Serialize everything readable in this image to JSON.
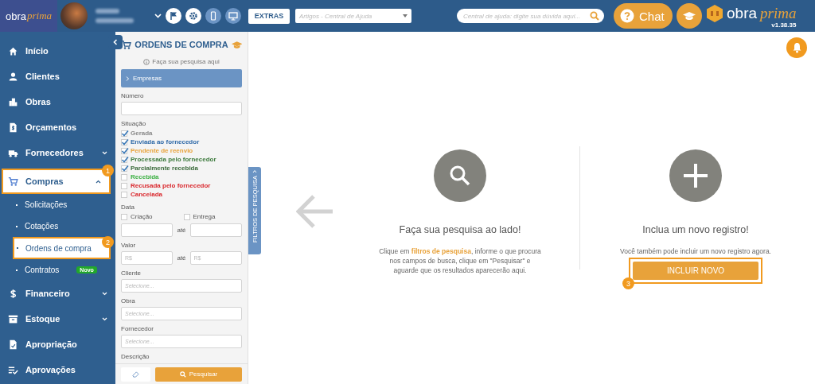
{
  "header": {
    "logo": {
      "first": "obra",
      "second": "prima"
    },
    "extras_button": "EXTRAS",
    "article_select": {
      "placeholder": "Artigos - Central de Ajuda"
    },
    "help_search": {
      "placeholder": "Central de ajuda: digite sua dúvida aqui..."
    },
    "chat_button": "Chat",
    "brand": {
      "first": "obra",
      "second": "prima",
      "version": "v1.38.35"
    }
  },
  "sidebar": {
    "items": [
      {
        "label": "Início",
        "selected": false
      },
      {
        "label": "Clientes",
        "selected": false
      },
      {
        "label": "Obras",
        "selected": false
      },
      {
        "label": "Orçamentos",
        "selected": false
      },
      {
        "label": "Fornecedores",
        "selected": false,
        "expanded": false
      },
      {
        "label": "Compras",
        "selected": true,
        "expanded": true,
        "callout": "1",
        "children": [
          {
            "label": "Solicitações",
            "selected": false
          },
          {
            "label": "Cotações",
            "selected": false
          },
          {
            "label": "Ordens de compra",
            "selected": true,
            "callout": "2"
          },
          {
            "label": "Contratos",
            "selected": false,
            "badge": "Novo"
          }
        ]
      },
      {
        "label": "Financeiro",
        "selected": false,
        "expanded": false
      },
      {
        "label": "Estoque",
        "selected": false,
        "expanded": false
      },
      {
        "label": "Apropriação",
        "selected": false
      },
      {
        "label": "Aprovações",
        "selected": false
      }
    ]
  },
  "filters": {
    "title": "ORDENS DE COMPRA",
    "hint": "Faça sua pesquisa aqui",
    "section": {
      "label": "Empresas",
      "expanded": false
    },
    "numero": {
      "label": "Número"
    },
    "situacao": {
      "label": "Situação",
      "options": [
        {
          "label": "Gerada",
          "checked": true,
          "color": "#8a8a8a"
        },
        {
          "label": "Enviada ao fornecedor",
          "checked": true,
          "color": "#2f6aa8"
        },
        {
          "label": "Pendente de reenvio",
          "checked": true,
          "color": "#e8a23a"
        },
        {
          "label": "Processada pelo fornecedor",
          "checked": true,
          "color": "#3d7a3d"
        },
        {
          "label": "Parcialmente recebida",
          "checked": true,
          "color": "#3a6a3a"
        },
        {
          "label": "Recebida",
          "checked": false,
          "color": "#3cb043"
        },
        {
          "label": "Recusada pelo fornecedor",
          "checked": false,
          "color": "#d9262b"
        },
        {
          "label": "Cancelada",
          "checked": false,
          "color": "#d9262b"
        }
      ]
    },
    "data": {
      "label": "Data",
      "options": [
        {
          "label": "Criação",
          "checked": false
        },
        {
          "label": "Entrega",
          "checked": false
        }
      ],
      "separator": "até"
    },
    "valor": {
      "label": "Valor",
      "from_placeholder": "R$",
      "separator": "até",
      "to_placeholder": "R$"
    },
    "selects": [
      {
        "label": "Cliente",
        "placeholder": "Selecione..."
      },
      {
        "label": "Obra",
        "placeholder": "Selecione..."
      },
      {
        "label": "Fornecedor",
        "placeholder": "Selecione..."
      }
    ],
    "next_label": "Descrição",
    "search_button": "Pesquisar",
    "side_tab": "FILTROS DE PESQUISA"
  },
  "main": {
    "search_panel": {
      "title": "Faça sua pesquisa ao lado!",
      "text_before": "Clique em ",
      "link": "filtros de pesquisa",
      "text_after": ", informe o que procura nos campos de busca, clique em \"Pesquisar\" e aguarde que os resultados aparecerão aqui."
    },
    "new_panel": {
      "title": "Inclua um novo registro!",
      "text": "Você também pode incluir um novo registro agora.",
      "button": "INCLUIR NOVO",
      "callout": "3"
    }
  }
}
